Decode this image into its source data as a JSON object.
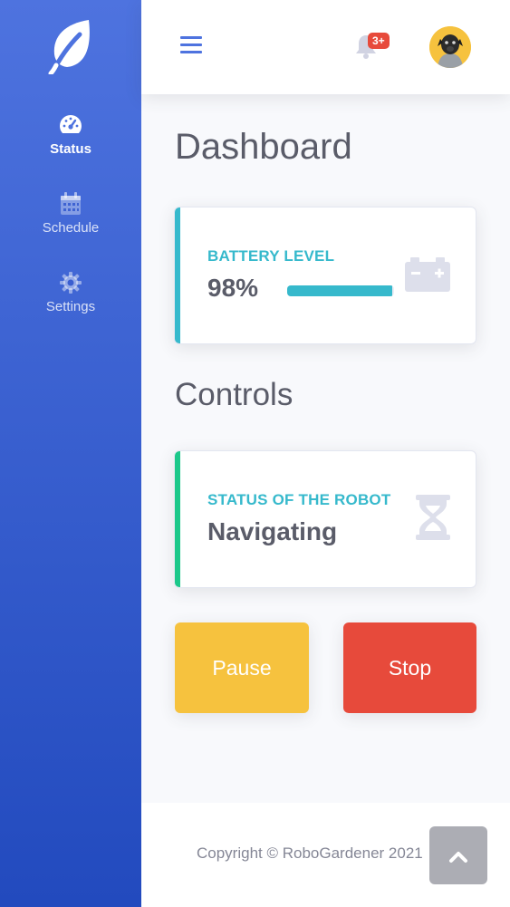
{
  "sidebar": {
    "brand_icon": "leaf-icon",
    "items": [
      {
        "label": "Status",
        "icon": "speedometer-icon",
        "active": true
      },
      {
        "label": "Schedule",
        "icon": "calendar-icon",
        "active": false
      },
      {
        "label": "Settings",
        "icon": "gear-icon",
        "active": false
      }
    ]
  },
  "topbar": {
    "menu_icon": "hamburger-icon",
    "notifications_icon": "bell-icon",
    "notifications_badge": "3+",
    "avatar": "user-avatar"
  },
  "main": {
    "title": "Dashboard",
    "battery": {
      "label": "BATTERY LEVEL",
      "value": "98%",
      "progress": 0.98,
      "icon": "car-battery-icon",
      "accent": "#36b9cc"
    },
    "controls_title": "Controls",
    "status": {
      "label": "STATUS OF THE ROBOT",
      "value": "Navigating",
      "icon": "hourglass-icon",
      "accent": "#1cc88a",
      "label_color": "#36b9cc"
    },
    "buttons": {
      "pause_label": "Pause",
      "stop_label": "Stop"
    }
  },
  "footer": {
    "copyright": "Copyright © RoboGardener 2021",
    "scroll_top_icon": "chevron-up-icon"
  },
  "colors": {
    "primary": "#4e73df",
    "info": "#36b9cc",
    "success": "#1cc88a",
    "warning": "#f6c23e",
    "danger": "#e74a3b"
  }
}
